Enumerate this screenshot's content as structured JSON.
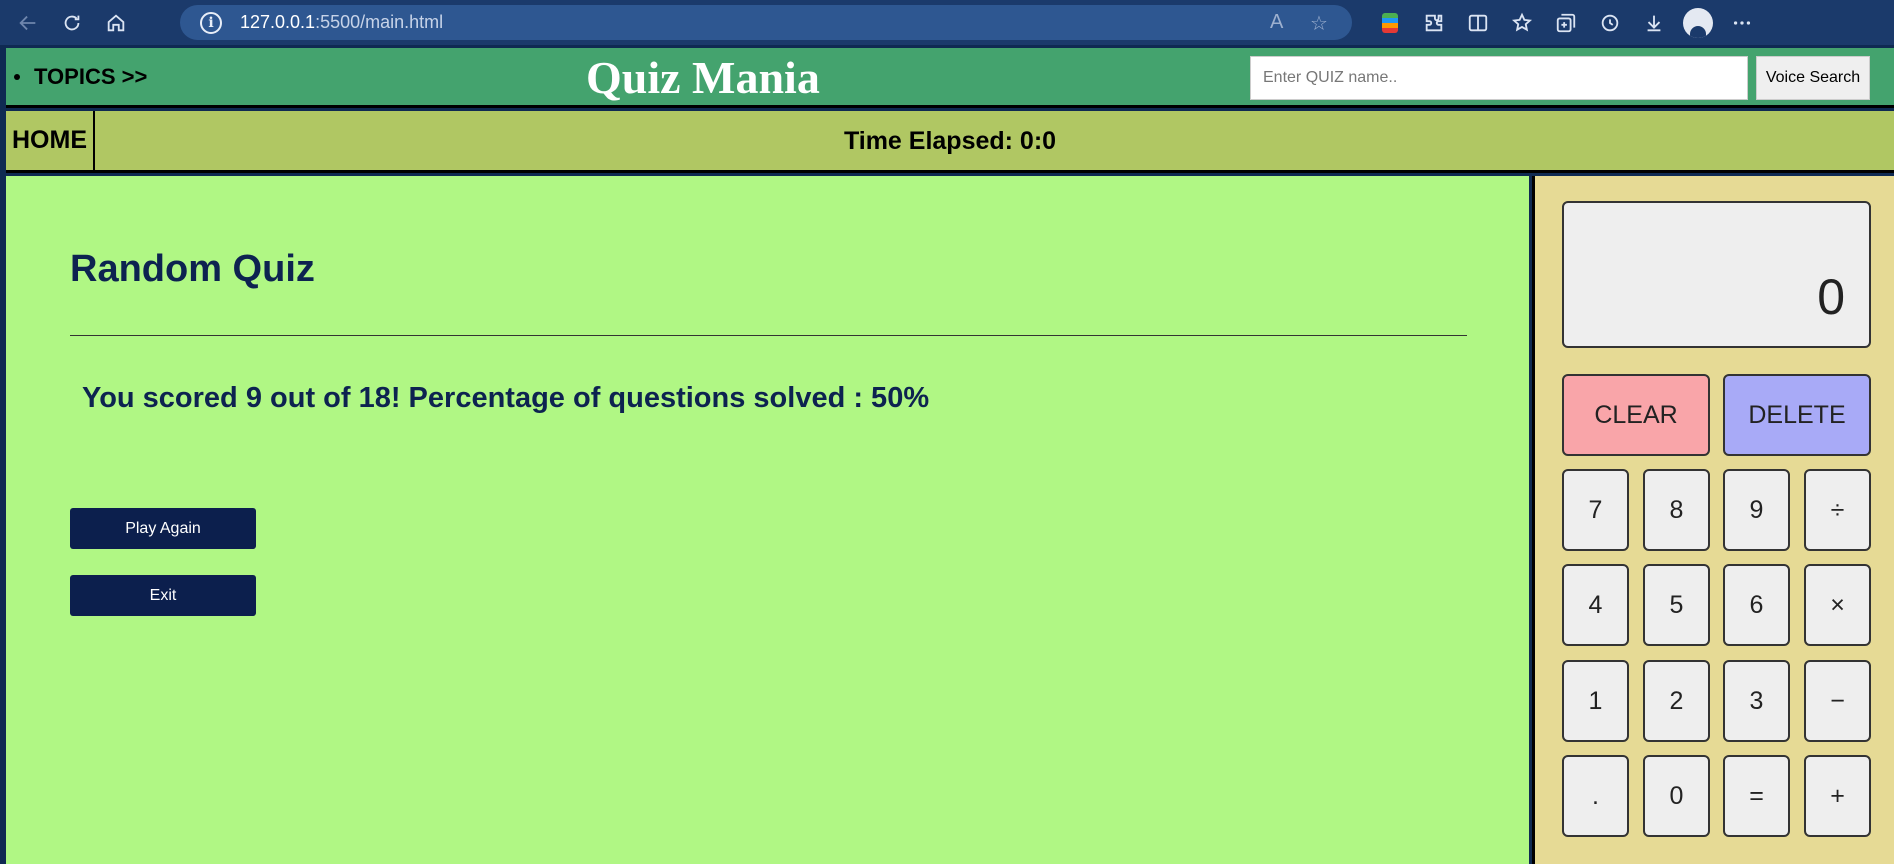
{
  "browser": {
    "url_host": "127.0.0.1",
    "url_rest": ":5500/main.html",
    "info_glyph": "i",
    "read_aloud_glyph": "A",
    "favorite_glyph": "☆"
  },
  "header": {
    "topics_label": "TOPICS >>",
    "site_title": "Quiz Mania",
    "search_placeholder": "Enter QUIZ name..",
    "voice_search_label": "Voice Search"
  },
  "subbar": {
    "home_label": "HOME",
    "timer_text": "Time Elapsed: 0:0"
  },
  "quiz": {
    "title": "Random Quiz",
    "score_text": "You scored 9 out of 18! Percentage of questions solved : 50%",
    "play_again_label": "Play Again",
    "exit_label": "Exit"
  },
  "calculator": {
    "display": "0",
    "clear_label": "CLEAR",
    "delete_label": "DELETE",
    "keys": [
      "7",
      "8",
      "9",
      "÷",
      "4",
      "5",
      "6",
      "×",
      "1",
      "2",
      "3",
      "−",
      ".",
      "0",
      "=",
      "+"
    ]
  },
  "colors": {
    "header_bg": "#44a36e",
    "subbar_bg": "#b0c763",
    "main_bg": "#b0f784",
    "calc_bg": "#e6da95",
    "button_bg": "#0c1f4d",
    "clear_bg": "#f9a5a9",
    "delete_bg": "#a8aaf7"
  }
}
